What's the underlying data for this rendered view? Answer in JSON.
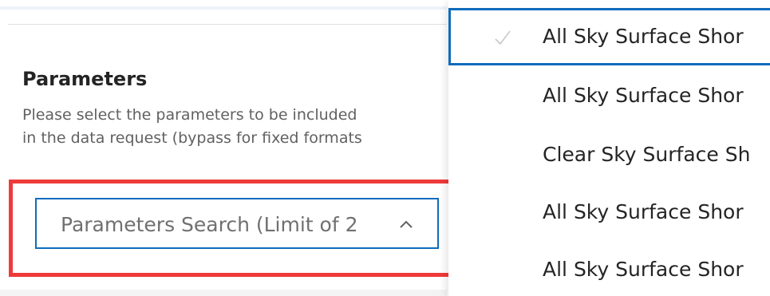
{
  "parameters": {
    "title": "Parameters",
    "description_lines": [
      "Please select the parameters to be included",
      "in the data request (bypass for fixed formats"
    ]
  },
  "search": {
    "placeholder": "Parameters Search (Limit of 2",
    "chevron_icon": "chevron-up-icon"
  },
  "dropdown": {
    "options": [
      {
        "label": "All Sky Surface Shor",
        "selected": true,
        "icon": "check-icon"
      },
      {
        "label": "All Sky Surface Shor",
        "selected": false
      },
      {
        "label": "Clear Sky Surface Sh",
        "selected": false
      },
      {
        "label": "All Sky Surface Shor",
        "selected": false
      },
      {
        "label": "All Sky Surface Shor",
        "selected": false
      }
    ]
  },
  "colors": {
    "accent": "#0f6cbd",
    "highlight": "#ef3a3a"
  }
}
